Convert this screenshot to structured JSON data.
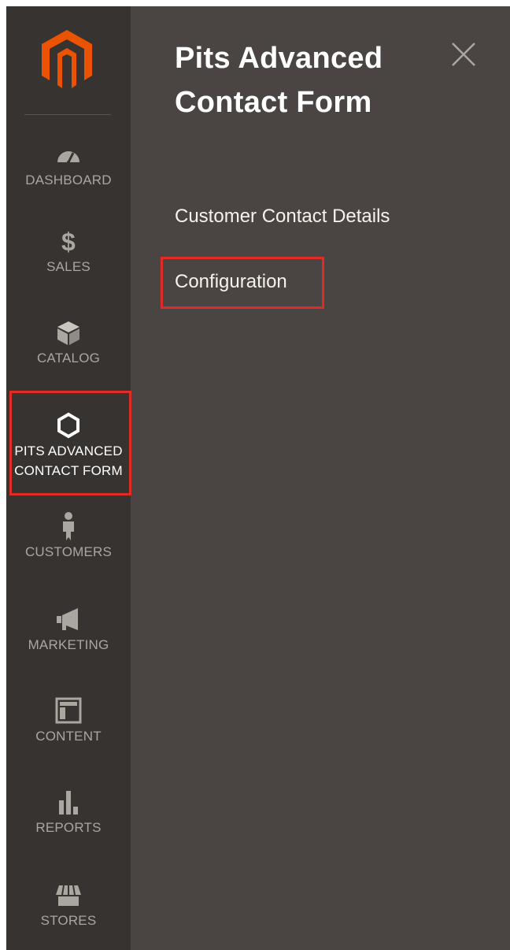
{
  "sidebar": {
    "logo_icon": "magento-logo-icon",
    "items": [
      {
        "label": "DASHBOARD",
        "icon": "gauge-icon"
      },
      {
        "label": "SALES",
        "icon": "dollar-icon"
      },
      {
        "label": "CATALOG",
        "icon": "box-icon"
      },
      {
        "label": "PITS ADVANCED",
        "label2": "CONTACT FORM",
        "icon": "hexagon-icon",
        "active": true
      },
      {
        "label": "CUSTOMERS",
        "icon": "person-icon"
      },
      {
        "label": "MARKETING",
        "icon": "megaphone-icon"
      },
      {
        "label": "CONTENT",
        "icon": "layout-icon"
      },
      {
        "label": "REPORTS",
        "icon": "bar-chart-icon"
      },
      {
        "label": "STORES",
        "icon": "storefront-icon"
      }
    ]
  },
  "panel": {
    "title_line1": "Pits Advanced",
    "title_line2": "Contact Form",
    "close_icon": "close-icon",
    "items": [
      {
        "label": "Customer Contact Details"
      },
      {
        "label": "Configuration",
        "highlighted": true
      }
    ]
  },
  "colors": {
    "sidebar_bg": "#373330",
    "panel_bg": "#4a4542",
    "brand_orange": "#eb5202",
    "highlight_red": "#e02b27"
  }
}
